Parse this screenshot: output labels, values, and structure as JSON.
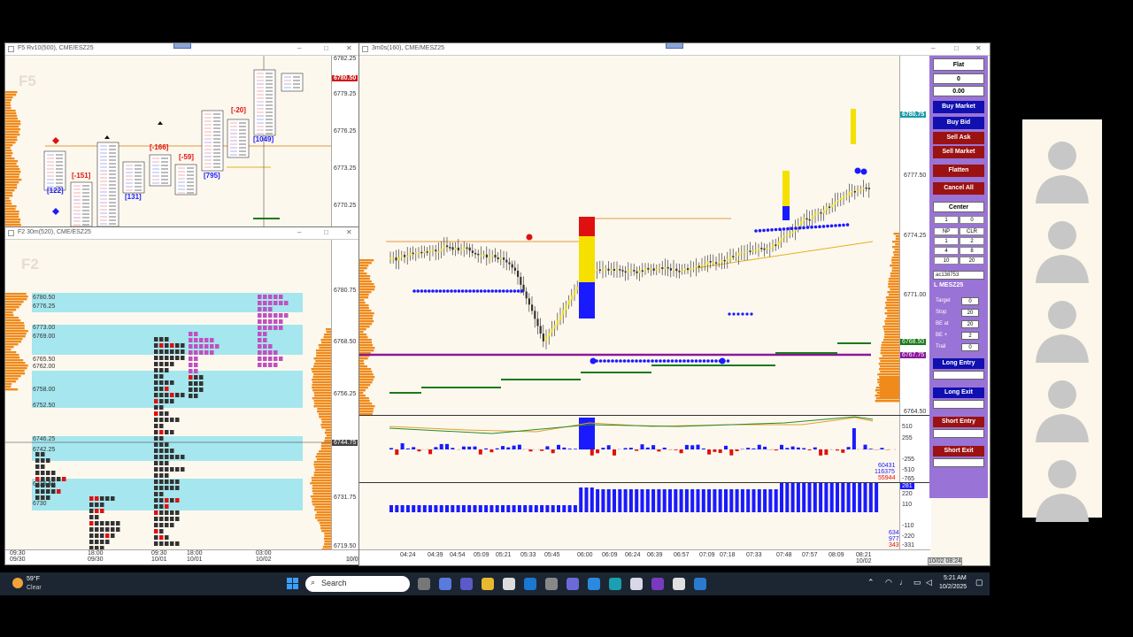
{
  "windows": {
    "f5": {
      "title": "F5 Rv10(500), CME/ESZ25",
      "watermark": "F5",
      "axis_labels": [
        "6782.25",
        "6779.25",
        "6776.25",
        "6773.25",
        "6770.25"
      ],
      "price_box": "6780.50",
      "delta_labels": [
        "[-151]",
        "[-166]",
        "[-59]",
        "[-20]"
      ],
      "volume_labels": [
        "[122]",
        "[131]",
        "[795]",
        "[1049]"
      ]
    },
    "f2": {
      "title": "F2 30m(520), CME/ESZ25",
      "watermark": "F2",
      "axis_labels": [
        "6780.75",
        "6768.50",
        "6756.25",
        "6744.75",
        "6731.75",
        "6719.50"
      ],
      "level_labels": [
        "6780.50",
        "6776.25",
        "6773.00",
        "6769.00",
        "6765.50",
        "6762.00",
        "6758.00",
        "6752.50",
        "6746.25",
        "6742.25",
        "6735.50",
        "6730"
      ],
      "time_labels": [
        {
          "t": "09:30",
          "d": "09/30"
        },
        {
          "t": "18:00",
          "d": "09/30"
        },
        {
          "t": "09:30",
          "d": "10/01"
        },
        {
          "t": "18:00",
          "d": "10/01"
        },
        {
          "t": "03:00",
          "d": "10/02"
        }
      ],
      "bottom_value": "10/0"
    },
    "main": {
      "title": "3m0s(160), CME/MESZ25",
      "axis_labels": [
        "6777.50",
        "6774.25",
        "6771.00",
        "6764.50"
      ],
      "price_box": "6780.75",
      "green_box": "6768.50",
      "purple_box": "6767.75",
      "osc1_labels": [
        "510",
        "255",
        "-255",
        "-510",
        "-765"
      ],
      "osc1_values": [
        "60431",
        "116375",
        "55944"
      ],
      "osc2_labels": [
        "220",
        "110",
        "-110",
        "-220",
        "-331"
      ],
      "osc2_values": [
        "634",
        "977",
        "343"
      ],
      "osc2_badge": "281",
      "time_labels": [
        "04:24",
        "04:39",
        "04:54",
        "05:09",
        "05:21",
        "05:33",
        "05:45",
        "06:00",
        "06:09",
        "06:24",
        "06:39",
        "06:57",
        "07:09",
        "07:18",
        "07:33",
        "07:48",
        "07:57",
        "08:09",
        "08:21"
      ],
      "last_date": "10/02",
      "corner_stamp": "10/02 08:24"
    }
  },
  "sidebar": {
    "position": "Flat",
    "qty": "0",
    "pnl": "0.00",
    "buy_market": "Buy Market",
    "buy_bid": "Buy Bid",
    "sell_ask": "Sell Ask",
    "sell_market": "Sell Market",
    "flatten": "Flatten",
    "cancel_all": "Cancel All",
    "center": "Center",
    "grid": [
      "1",
      "0",
      "NP",
      "CLR",
      "1",
      "2",
      "4",
      "8",
      "10",
      "20"
    ],
    "account": "ac138753",
    "symbol": "L MESZ25",
    "params": [
      {
        "label": "Target",
        "value": "0"
      },
      {
        "label": "Stop",
        "value": "20"
      },
      {
        "label": "BE at",
        "value": "20"
      },
      {
        "label": "BE +",
        "value": "2"
      },
      {
        "label": "Trail",
        "value": "0"
      }
    ],
    "long_entry": "Long Entry",
    "long_exit": "Long Exit",
    "short_entry": "Short Entry",
    "short_exit": "Short Exit"
  },
  "taskbar": {
    "temp": "59°F",
    "weather": "Clear",
    "search_placeholder": "Search",
    "time": "5:21 AM",
    "date": "10/2/2025"
  },
  "colors": {
    "bull": "#1a1aff",
    "bear": "#e01010",
    "profile": "#f08a1a",
    "band": "#a6e6ee",
    "purple_line": "#8a1a9a",
    "green_line": "#1a7a1a",
    "sidebar": "#9a73d6"
  }
}
